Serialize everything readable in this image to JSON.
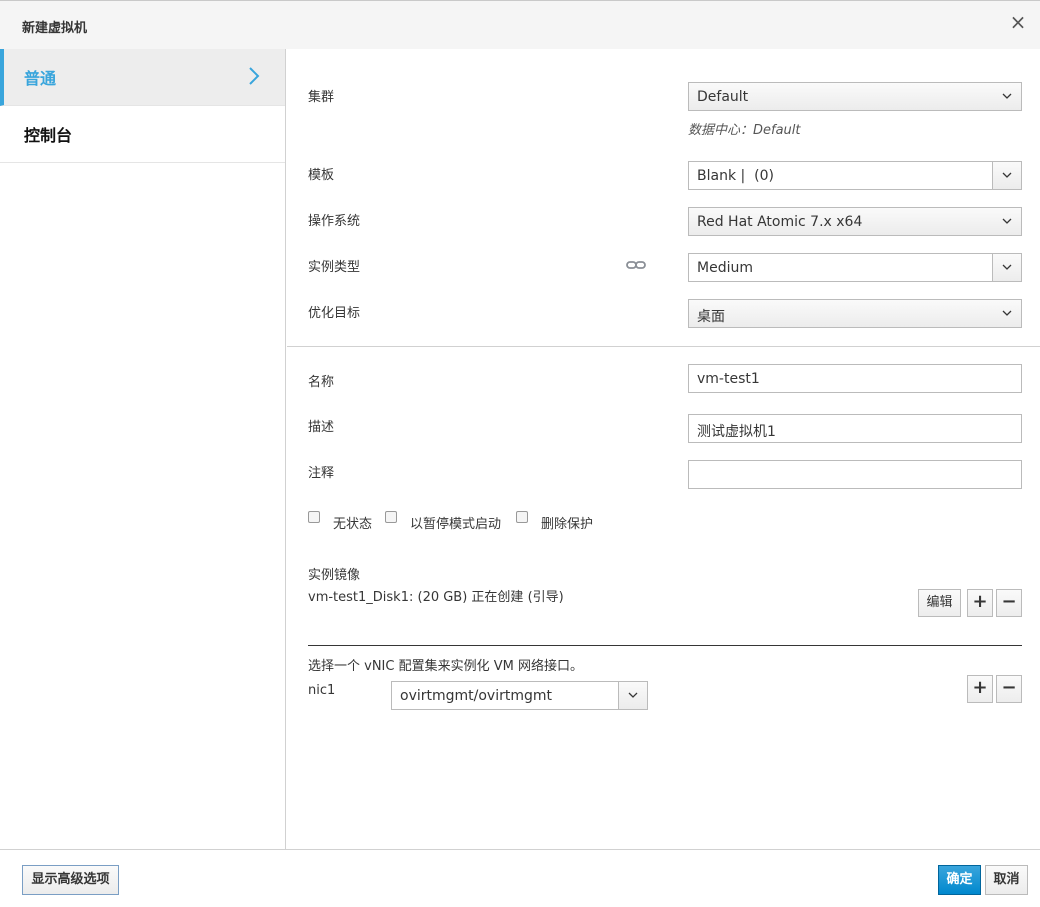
{
  "dialog": {
    "title": "新建虚拟机"
  },
  "sidebar": {
    "tabs": [
      {
        "label": "普通"
      },
      {
        "label": "控制台"
      }
    ]
  },
  "form": {
    "cluster": {
      "label": "集群",
      "value": "Default",
      "hint": "数据中心：Default"
    },
    "template": {
      "label": "模板",
      "value": "Blank |  (0)"
    },
    "os": {
      "label": "操作系统",
      "value": "Red Hat Atomic 7.x x64"
    },
    "instance_type": {
      "label": "实例类型",
      "value": "Medium",
      "icon": "link-icon"
    },
    "optimized_for": {
      "label": "优化目标",
      "value": "桌面"
    },
    "name": {
      "label": "名称",
      "value": "vm-test1"
    },
    "description": {
      "label": "描述",
      "value": "测试虚拟机1"
    },
    "comment": {
      "label": "注释",
      "value": ""
    },
    "checkboxes": [
      {
        "label": "无状态"
      },
      {
        "label": "以暂停模式启动"
      },
      {
        "label": "删除保护"
      }
    ],
    "instance_images": {
      "label": "实例镜像",
      "disk": "vm-test1_Disk1: (20 GB) 正在创建 (引导)",
      "edit_label": "编辑",
      "add_symbol": "+",
      "remove_symbol": "−"
    },
    "vnic": {
      "instruction": "选择一个 vNIC 配置集来实例化 VM 网络接口。",
      "nic_label": "nic1",
      "nic_value": "ovirtmgmt/ovirtmgmt",
      "add_symbol": "+",
      "remove_symbol": "−"
    }
  },
  "footer": {
    "advanced_label": "显示高级选项",
    "ok_label": "确定",
    "cancel_label": "取消"
  },
  "colors": {
    "accent": "#39a5dc",
    "primary": "#0088ce"
  }
}
